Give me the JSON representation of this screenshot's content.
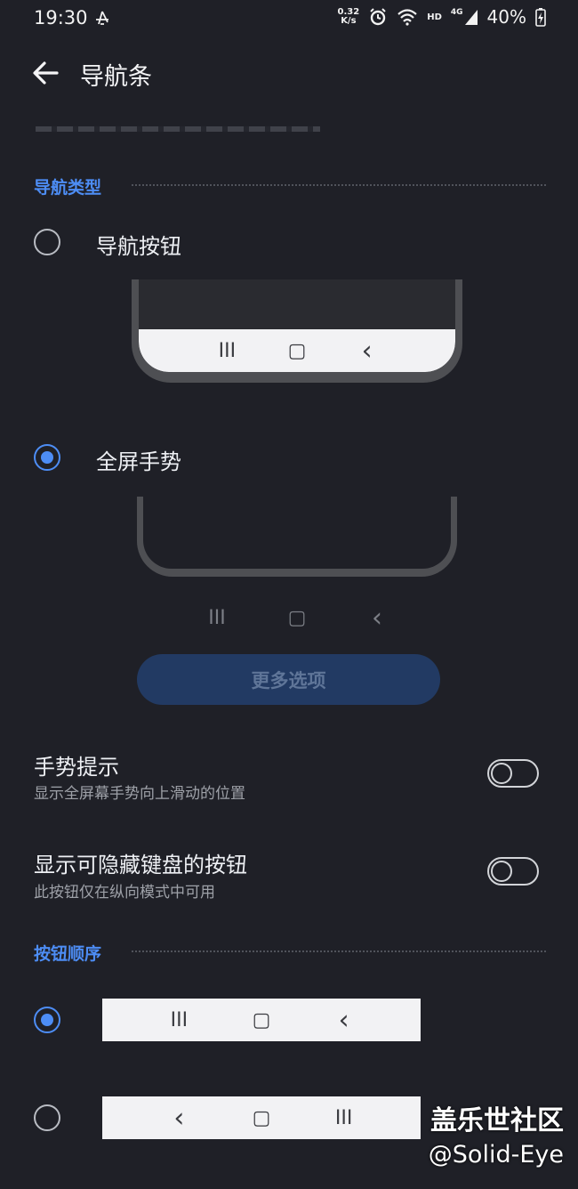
{
  "status": {
    "time": "19:30",
    "speed_value": "0.32",
    "speed_unit": "K/s",
    "hd": "HD",
    "network": "4G",
    "battery": "40%"
  },
  "header": {
    "title": "导航条"
  },
  "nav_type": {
    "section_title": "导航类型",
    "options": [
      {
        "label": "导航按钮",
        "selected": false
      },
      {
        "label": "全屏手势",
        "selected": true
      }
    ]
  },
  "more_options_label": "更多选项",
  "settings": [
    {
      "title": "手势提示",
      "subtitle": "显示全屏幕手势向上滑动的位置",
      "on": false
    },
    {
      "title": "显示可隐藏键盘的按钮",
      "subtitle": "此按钮仅在纵向模式中可用",
      "on": false
    }
  ],
  "button_order": {
    "section_title": "按钮顺序",
    "options": [
      {
        "selected": true,
        "icons": [
          "recents-icon",
          "home-icon",
          "back-icon"
        ]
      },
      {
        "selected": false,
        "icons": [
          "back-icon",
          "home-icon",
          "recents-icon"
        ]
      }
    ]
  },
  "nav_glyphs": {
    "recents": "III",
    "home": "▢",
    "back": "‹"
  },
  "watermark": {
    "line1": "盖乐世社区",
    "line2": "@Solid-Eye"
  },
  "colors": {
    "accent": "#4d8df5",
    "background": "#1f2027",
    "button_bg": "#223a63"
  }
}
